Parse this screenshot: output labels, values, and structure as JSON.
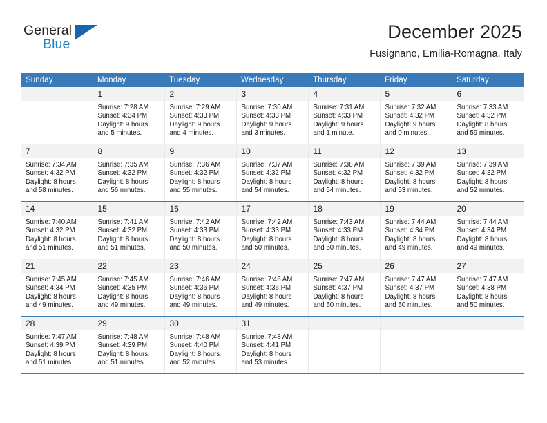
{
  "logo": {
    "word_one": "General",
    "word_two": "Blue",
    "triangle_icon": "triangle-icon"
  },
  "header": {
    "title": "December 2025",
    "subtitle": "Fusignano, Emilia-Romagna, Italy"
  },
  "colors": {
    "header_blue": "#3a7ab8",
    "logo_blue": "#1b7fc4",
    "daynum_band": "#f2f2f2",
    "text": "#1a1a1a"
  },
  "weekday_headers": [
    "Sunday",
    "Monday",
    "Tuesday",
    "Wednesday",
    "Thursday",
    "Friday",
    "Saturday"
  ],
  "weeks": [
    [
      {
        "day": "",
        "lines": []
      },
      {
        "day": "1",
        "lines": [
          "Sunrise: 7:28 AM",
          "Sunset: 4:34 PM",
          "Daylight: 9 hours",
          "and 5 minutes."
        ]
      },
      {
        "day": "2",
        "lines": [
          "Sunrise: 7:29 AM",
          "Sunset: 4:33 PM",
          "Daylight: 9 hours",
          "and 4 minutes."
        ]
      },
      {
        "day": "3",
        "lines": [
          "Sunrise: 7:30 AM",
          "Sunset: 4:33 PM",
          "Daylight: 9 hours",
          "and 3 minutes."
        ]
      },
      {
        "day": "4",
        "lines": [
          "Sunrise: 7:31 AM",
          "Sunset: 4:33 PM",
          "Daylight: 9 hours",
          "and 1 minute."
        ]
      },
      {
        "day": "5",
        "lines": [
          "Sunrise: 7:32 AM",
          "Sunset: 4:32 PM",
          "Daylight: 9 hours",
          "and 0 minutes."
        ]
      },
      {
        "day": "6",
        "lines": [
          "Sunrise: 7:33 AM",
          "Sunset: 4:32 PM",
          "Daylight: 8 hours",
          "and 59 minutes."
        ]
      }
    ],
    [
      {
        "day": "7",
        "lines": [
          "Sunrise: 7:34 AM",
          "Sunset: 4:32 PM",
          "Daylight: 8 hours",
          "and 58 minutes."
        ]
      },
      {
        "day": "8",
        "lines": [
          "Sunrise: 7:35 AM",
          "Sunset: 4:32 PM",
          "Daylight: 8 hours",
          "and 56 minutes."
        ]
      },
      {
        "day": "9",
        "lines": [
          "Sunrise: 7:36 AM",
          "Sunset: 4:32 PM",
          "Daylight: 8 hours",
          "and 55 minutes."
        ]
      },
      {
        "day": "10",
        "lines": [
          "Sunrise: 7:37 AM",
          "Sunset: 4:32 PM",
          "Daylight: 8 hours",
          "and 54 minutes."
        ]
      },
      {
        "day": "11",
        "lines": [
          "Sunrise: 7:38 AM",
          "Sunset: 4:32 PM",
          "Daylight: 8 hours",
          "and 54 minutes."
        ]
      },
      {
        "day": "12",
        "lines": [
          "Sunrise: 7:39 AM",
          "Sunset: 4:32 PM",
          "Daylight: 8 hours",
          "and 53 minutes."
        ]
      },
      {
        "day": "13",
        "lines": [
          "Sunrise: 7:39 AM",
          "Sunset: 4:32 PM",
          "Daylight: 8 hours",
          "and 52 minutes."
        ]
      }
    ],
    [
      {
        "day": "14",
        "lines": [
          "Sunrise: 7:40 AM",
          "Sunset: 4:32 PM",
          "Daylight: 8 hours",
          "and 51 minutes."
        ]
      },
      {
        "day": "15",
        "lines": [
          "Sunrise: 7:41 AM",
          "Sunset: 4:32 PM",
          "Daylight: 8 hours",
          "and 51 minutes."
        ]
      },
      {
        "day": "16",
        "lines": [
          "Sunrise: 7:42 AM",
          "Sunset: 4:33 PM",
          "Daylight: 8 hours",
          "and 50 minutes."
        ]
      },
      {
        "day": "17",
        "lines": [
          "Sunrise: 7:42 AM",
          "Sunset: 4:33 PM",
          "Daylight: 8 hours",
          "and 50 minutes."
        ]
      },
      {
        "day": "18",
        "lines": [
          "Sunrise: 7:43 AM",
          "Sunset: 4:33 PM",
          "Daylight: 8 hours",
          "and 50 minutes."
        ]
      },
      {
        "day": "19",
        "lines": [
          "Sunrise: 7:44 AM",
          "Sunset: 4:34 PM",
          "Daylight: 8 hours",
          "and 49 minutes."
        ]
      },
      {
        "day": "20",
        "lines": [
          "Sunrise: 7:44 AM",
          "Sunset: 4:34 PM",
          "Daylight: 8 hours",
          "and 49 minutes."
        ]
      }
    ],
    [
      {
        "day": "21",
        "lines": [
          "Sunrise: 7:45 AM",
          "Sunset: 4:34 PM",
          "Daylight: 8 hours",
          "and 49 minutes."
        ]
      },
      {
        "day": "22",
        "lines": [
          "Sunrise: 7:45 AM",
          "Sunset: 4:35 PM",
          "Daylight: 8 hours",
          "and 49 minutes."
        ]
      },
      {
        "day": "23",
        "lines": [
          "Sunrise: 7:46 AM",
          "Sunset: 4:36 PM",
          "Daylight: 8 hours",
          "and 49 minutes."
        ]
      },
      {
        "day": "24",
        "lines": [
          "Sunrise: 7:46 AM",
          "Sunset: 4:36 PM",
          "Daylight: 8 hours",
          "and 49 minutes."
        ]
      },
      {
        "day": "25",
        "lines": [
          "Sunrise: 7:47 AM",
          "Sunset: 4:37 PM",
          "Daylight: 8 hours",
          "and 50 minutes."
        ]
      },
      {
        "day": "26",
        "lines": [
          "Sunrise: 7:47 AM",
          "Sunset: 4:37 PM",
          "Daylight: 8 hours",
          "and 50 minutes."
        ]
      },
      {
        "day": "27",
        "lines": [
          "Sunrise: 7:47 AM",
          "Sunset: 4:38 PM",
          "Daylight: 8 hours",
          "and 50 minutes."
        ]
      }
    ],
    [
      {
        "day": "28",
        "lines": [
          "Sunrise: 7:47 AM",
          "Sunset: 4:39 PM",
          "Daylight: 8 hours",
          "and 51 minutes."
        ]
      },
      {
        "day": "29",
        "lines": [
          "Sunrise: 7:48 AM",
          "Sunset: 4:39 PM",
          "Daylight: 8 hours",
          "and 51 minutes."
        ]
      },
      {
        "day": "30",
        "lines": [
          "Sunrise: 7:48 AM",
          "Sunset: 4:40 PM",
          "Daylight: 8 hours",
          "and 52 minutes."
        ]
      },
      {
        "day": "31",
        "lines": [
          "Sunrise: 7:48 AM",
          "Sunset: 4:41 PM",
          "Daylight: 8 hours",
          "and 53 minutes."
        ]
      },
      {
        "day": "",
        "lines": []
      },
      {
        "day": "",
        "lines": []
      },
      {
        "day": "",
        "lines": []
      }
    ]
  ]
}
